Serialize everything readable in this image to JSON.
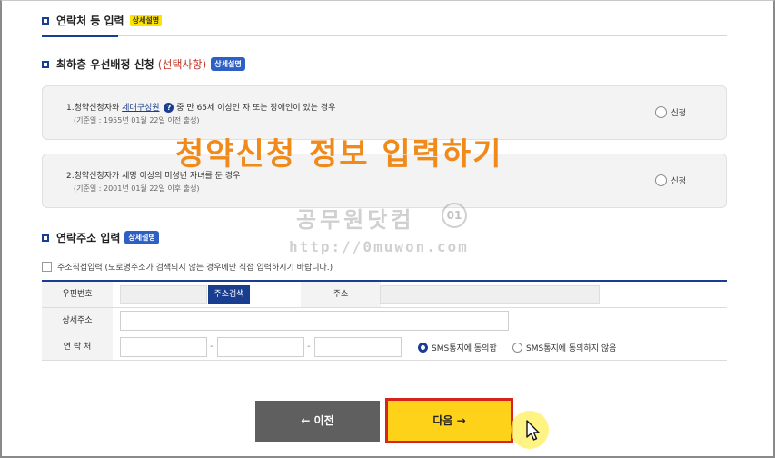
{
  "contact_section": {
    "title": "연락처 등 입력",
    "badge": "상세설명"
  },
  "priority_section": {
    "title": "최하층 우선배정 신청",
    "optional": "(선택사항)",
    "badge": "상세설명"
  },
  "option_cards": [
    {
      "text_prefix": "1.청약신청자와 ",
      "link": "세대구성원",
      "help_icon": "?",
      "text_suffix": " 중 만 65세 이상인 자 또는 장애인이 있는 경우",
      "note": "(기준일 : 1955년 01월 22일 이전 출생)",
      "radio_label": "신청"
    },
    {
      "text": "2.청약신청자가 세명 이상의 미성년 자녀를 둔 경우",
      "note": "(기준일 : 2001년 01월 22일 이후 출생)",
      "radio_label": "신청"
    }
  ],
  "overlay_title": "청약신청 정보 입력하기",
  "watermark": {
    "name": "공무원닷컴",
    "url": "http://0muwon.com"
  },
  "address_section": {
    "title": "연락주소 입력",
    "badge": "상세설명",
    "direct_input_label": "주소직접입력 (도로명주소가 검색되지 않는 경우에만 직접 입력하시기 바랍니다.)"
  },
  "form": {
    "postal_label": "우편번호",
    "search_button": "주소검색",
    "address_label": "주소",
    "detail_label": "상세주소",
    "contact_label": "연 락 처",
    "dash": "-",
    "sms_agree": "SMS통지에 동의함",
    "sms_disagree": "SMS통지에 동의하지 않음"
  },
  "buttons": {
    "prev": "← 이전",
    "next": "다음 →"
  },
  "colors": {
    "accent": "#1a3e8f",
    "next_button": "#ffd21a",
    "next_border": "#d9221c",
    "overlay_text": "#f08a1a"
  }
}
